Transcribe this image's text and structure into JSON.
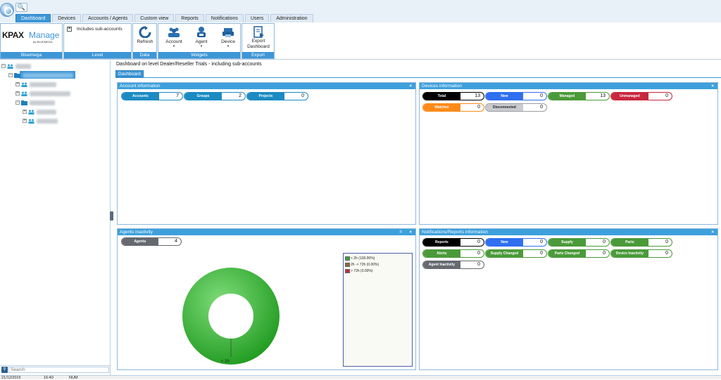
{
  "tabs": [
    "Dashboard",
    "Devices",
    "Accounts / Agents",
    "Custom view",
    "Reports",
    "Notifications",
    "Users",
    "Administration"
  ],
  "ribbon": {
    "logo": {
      "brand": "KPAX",
      "product": "Manage",
      "sub": "by BLUEMEGA"
    },
    "groups": {
      "bluemega": "Bluemega",
      "level": "Level",
      "data": "Data",
      "widgets": "Widgets",
      "export": "Export"
    },
    "includes_sub_accounts": "Includes sub-accounts",
    "refresh": "Refresh",
    "account": "Account",
    "agent": "Agent",
    "device": "Device",
    "export_dashboard": "Export\nDashboard"
  },
  "breadcrumb": "Dashboard on level Dealer/Reseller Trials - including sub-accounts",
  "dashboard_tab": "Dashboard",
  "search": {
    "placeholder": "Search"
  },
  "account_info": {
    "title": "Account information",
    "pills": [
      {
        "label": "Accounts",
        "value": "7",
        "color": "#1b8bc2"
      },
      {
        "label": "Groups",
        "value": "2",
        "color": "#1b8bc2"
      },
      {
        "label": "Projects",
        "value": "0",
        "color": "#1b8bc2"
      }
    ]
  },
  "devices_info": {
    "title": "Devices information",
    "pills": [
      {
        "label": "Total",
        "value": "13",
        "color": "#000000"
      },
      {
        "label": "New",
        "value": "0",
        "color": "#2f6ff0"
      },
      {
        "label": "Managed",
        "value": "13",
        "color": "#4b9a3a"
      },
      {
        "label": "Unmanaged",
        "value": "0",
        "color": "#c8283e"
      },
      {
        "label": "Watches",
        "value": "0",
        "color": "#ff8a1a"
      },
      {
        "label": "Disconnected",
        "value": "0",
        "color": "#c9cbd0"
      }
    ]
  },
  "agents_inactivity": {
    "title": "Agents inactivity",
    "pills": [
      {
        "label": "Agents",
        "value": "4",
        "color": "#666a70"
      }
    ],
    "donut_label": "< 2h",
    "legend": [
      {
        "label": "< 2h (100.00%)",
        "color": "#3aa33a"
      },
      {
        "label": "2h -> 72h (0.00%)",
        "color": "#8a6a3a"
      },
      {
        "label": "> 72h (0.00%)",
        "color": "#c8283e"
      }
    ]
  },
  "notifications_info": {
    "title": "Notifications/Reports information",
    "pills": [
      {
        "label": "Reports",
        "value": "0",
        "color": "#000000"
      },
      {
        "label": "New",
        "value": "0",
        "color": "#2f6ff0"
      },
      {
        "label": "Supply",
        "value": "0",
        "color": "#4b9a3a"
      },
      {
        "label": "Parts",
        "value": "0",
        "color": "#4b9a3a"
      },
      {
        "label": "Alerts",
        "value": "0",
        "color": "#4b9a3a"
      },
      {
        "label": "Supply Changed",
        "value": "0",
        "color": "#4b9a3a"
      },
      {
        "label": "Parts Changed",
        "value": "0",
        "color": "#4b9a3a"
      },
      {
        "label": "Device Inactivity",
        "value": "0",
        "color": "#4b9a3a"
      },
      {
        "label": "Agent Inactivity",
        "value": "0",
        "color": "#666a70"
      }
    ]
  },
  "statusbar": {
    "date": "21/12/2015",
    "time": "16:40",
    "mode": "NUM"
  }
}
